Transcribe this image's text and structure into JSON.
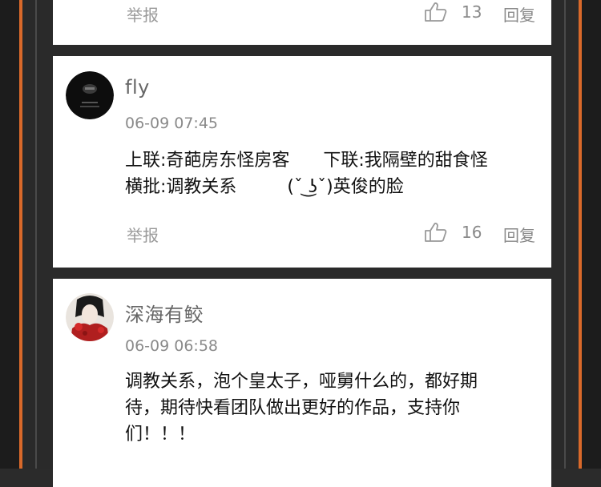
{
  "comments": [
    {
      "report_label": "举报",
      "likes": "13",
      "reply_label": "回复"
    },
    {
      "username": "fly",
      "date": "06-09 07:45",
      "content": "上联:奇葩房东怪房客      下联:我隔壁的甜食怪\n横批:调教关系         (ˇ ͜ʖˇ)英俊的脸",
      "report_label": "举报",
      "likes": "16",
      "reply_label": "回复"
    },
    {
      "username": "深海有鲛",
      "date": "06-09 06:58",
      "content": "调教关系，泡个皇太子，哑舅什么的，都好期\n待，期待快看团队做出更好的作品，支持你\n们！！！"
    }
  ],
  "colors": {
    "accent_orange": "#d9692a",
    "card_bg": "#ffffff",
    "frame_bg": "#2a2a2a"
  },
  "icons": [
    "thumbs-up-icon",
    "avatar-dark-portrait",
    "avatar-red-flower-girl"
  ]
}
